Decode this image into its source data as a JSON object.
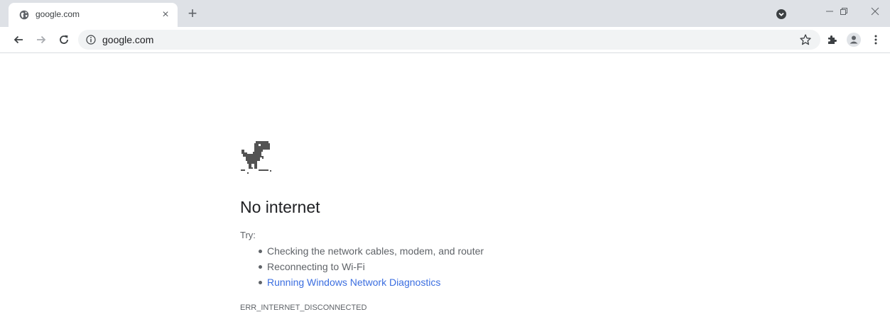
{
  "tab": {
    "title": "google.com",
    "close_glyph": "×",
    "favicon": "globe-icon"
  },
  "new_tab_glyph": "+",
  "window_controls": [
    "minimize-icon",
    "restore-icon",
    "close-icon"
  ],
  "toolbar": {
    "url": "google.com",
    "icons": [
      "back-arrow-icon",
      "forward-arrow-icon",
      "reload-icon",
      "info-icon",
      "star-icon",
      "extensions-icon",
      "profile-icon",
      "menu-icon"
    ]
  },
  "content": {
    "heading": "No internet",
    "try_label": "Try:",
    "suggestions": [
      "Checking the network cables, modem, and router",
      "Reconnecting to Wi-Fi",
      "Running Windows Network Diagnostics"
    ],
    "error_code": "ERR_INTERNET_DISCONNECTED"
  },
  "colors": {
    "tabstrip_bg": "#dee1e6",
    "omnibox_bg": "#f1f3f4",
    "text_primary": "#202124",
    "text_secondary": "#5f6368",
    "link": "#3b6ee0"
  }
}
